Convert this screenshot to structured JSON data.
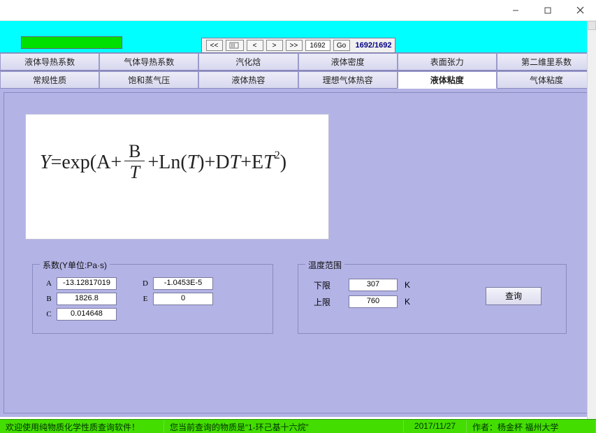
{
  "nav": {
    "page_input": "1692",
    "go_label": "Go",
    "total_label": "1692/1692",
    "first": "<<",
    "prev": "<",
    "next": ">",
    "last": ">>"
  },
  "tabs_row1": [
    {
      "label": "液体导热系数"
    },
    {
      "label": "气体导热系数"
    },
    {
      "label": "汽化焓"
    },
    {
      "label": "液体密度"
    },
    {
      "label": "表面张力"
    },
    {
      "label": "第二维里系数"
    }
  ],
  "tabs_row2": [
    {
      "label": "常规性质"
    },
    {
      "label": "饱和蒸气压"
    },
    {
      "label": "液体热容"
    },
    {
      "label": "理想气体热容"
    },
    {
      "label": "液体粘度",
      "active": true
    },
    {
      "label": "气体粘度"
    }
  ],
  "formula": {
    "Y": "Y",
    "eq": " =",
    "exp": "exp(A+",
    "frac_num": "B",
    "frac_den": "T",
    "plus_ln": "+Ln(",
    "T1": "T",
    "after_ln": ")+D",
    "T2": "T",
    "plus_e": "+E",
    "T3": "T",
    "sq": "2",
    "close": ")"
  },
  "coeff": {
    "legend": "系数(Y单位:Pa·s)",
    "labels": {
      "A": "A",
      "B": "B",
      "C": "C",
      "D": "D",
      "E": "E"
    },
    "values": {
      "A": "-13.12817019",
      "B": "1826.8",
      "C": "0.014648",
      "D": "-1.0453E-5",
      "E": "0"
    }
  },
  "range": {
    "legend": "温度范围",
    "lower_label": "下限",
    "upper_label": "上限",
    "lower_value": "307",
    "upper_value": "760",
    "unit": "K"
  },
  "query_button": "查询",
  "status": {
    "c1": "欢迎使用纯物质化学性质查询软件！",
    "c2": "您当前查询的物质是“1-环己基十六烷”",
    "c3": "2017/11/27",
    "c4": "作者：杨金杯  福州大学"
  }
}
